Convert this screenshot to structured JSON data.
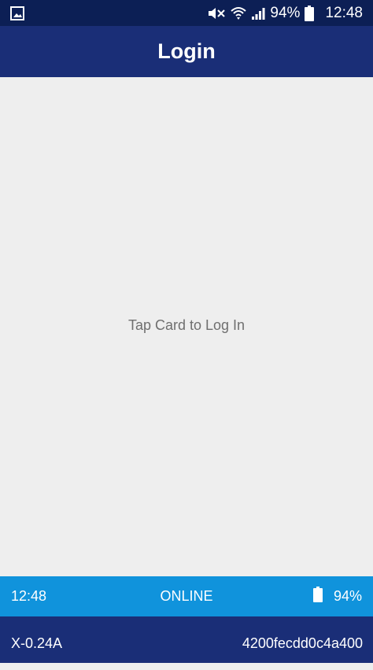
{
  "status_bar": {
    "icons": [
      "gallery-icon",
      "mute-icon",
      "wifi-icon",
      "signal-icon",
      "battery-icon"
    ],
    "battery_percent": "94%",
    "clock": "12:48"
  },
  "app_bar": {
    "title": "Login"
  },
  "main": {
    "prompt": "Tap Card to Log In"
  },
  "info_bar": {
    "time": "12:48",
    "connection_status": "ONLINE",
    "battery_percent": "94%",
    "battery_icon": "battery-full-icon"
  },
  "footer": {
    "version": "X-0.24A",
    "device_id": "4200fecdd0c4a400"
  },
  "colors": {
    "status_bar_bg": "#0c1f55",
    "app_bar_bg": "#1a2e77",
    "content_bg": "#eeeeee",
    "info_bar_bg": "#1093dc",
    "prompt_text": "#6f6f6f"
  }
}
